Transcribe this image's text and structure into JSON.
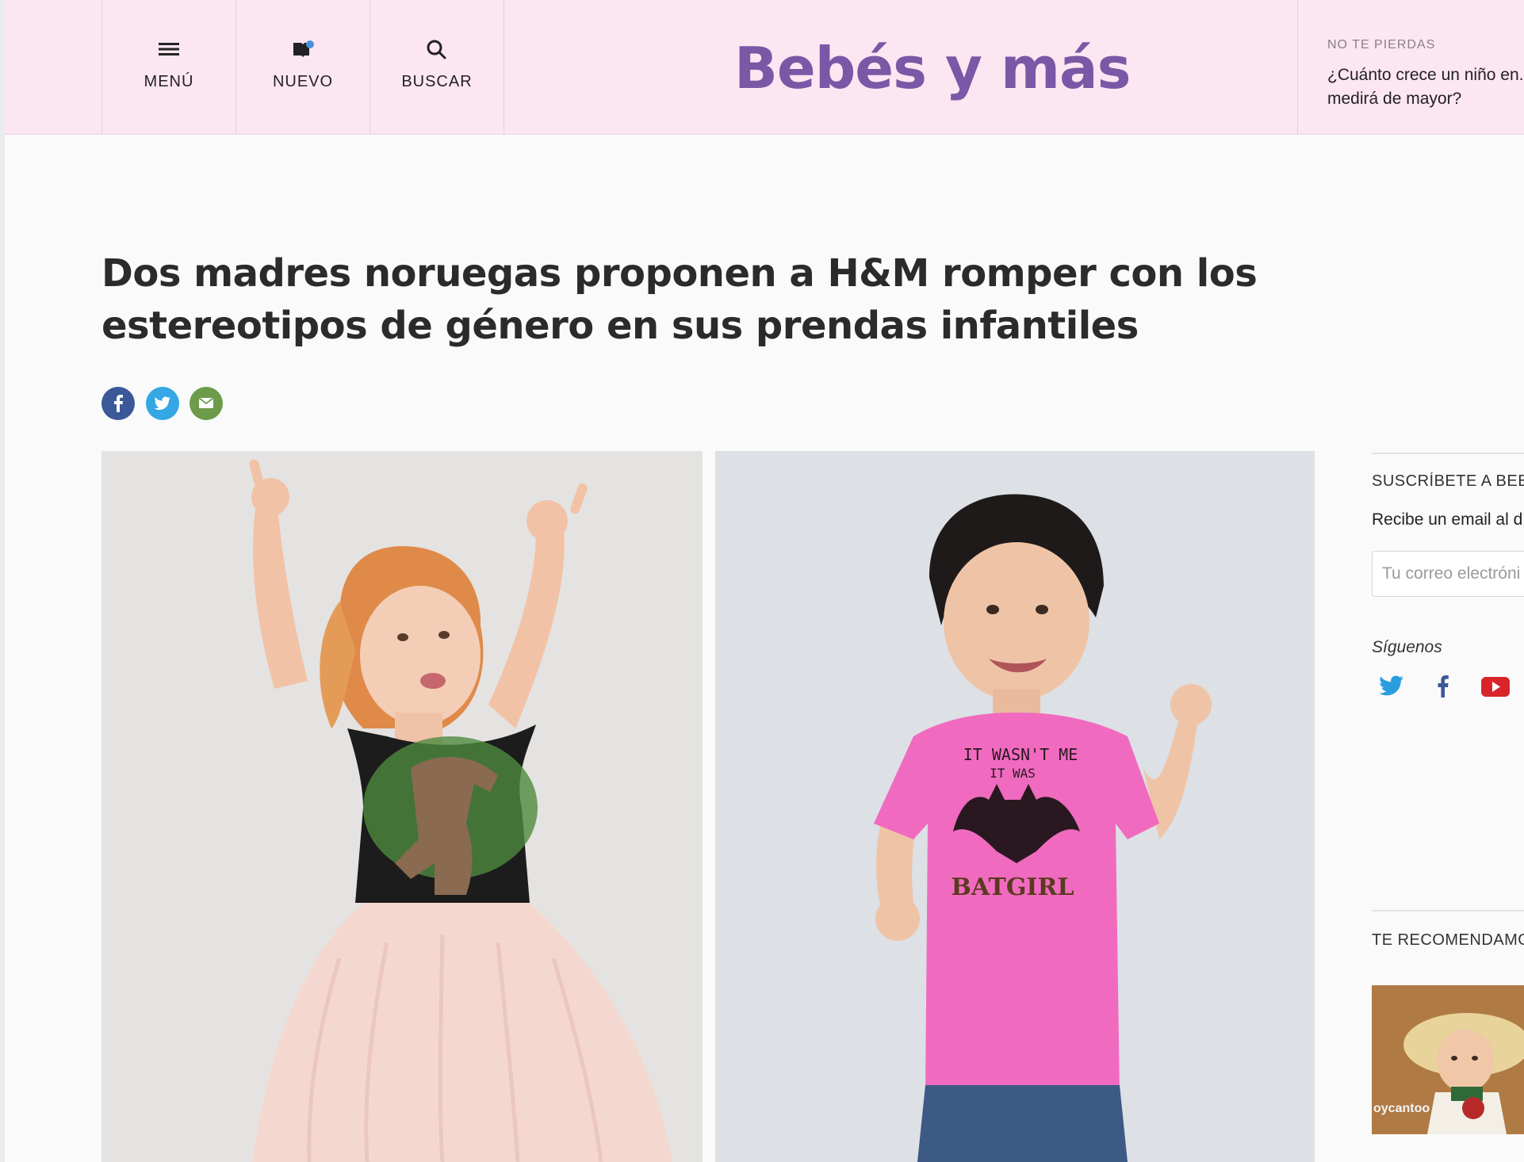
{
  "header": {
    "nav": [
      {
        "label": "MENÚ",
        "icon": "hamburger-icon"
      },
      {
        "label": "NUEVO",
        "icon": "new-book-icon"
      },
      {
        "label": "BUSCAR",
        "icon": "search-icon"
      }
    ],
    "logo": "Bebés y más",
    "promo": {
      "label": "NO TE PIERDAS",
      "text": "¿Cuánto crece un niño en... medirá de mayor?"
    },
    "colors": {
      "background": "#fce6f2",
      "logo": "#7b57a6"
    }
  },
  "article": {
    "title": "Dos madres noruegas proponen a H&M romper con los estereotipos de género en sus prendas infantiles",
    "share": [
      {
        "icon": "facebook-icon",
        "color": "#3b5998"
      },
      {
        "icon": "twitter-icon",
        "color": "#34a7e4"
      },
      {
        "icon": "email-icon",
        "color": "#6c9c4a"
      }
    ],
    "photos": {
      "left": {
        "shirt_text": ""
      },
      "right": {
        "shirt_text_line1": "IT WASN'T ME",
        "shirt_text_line2": "IT WAS",
        "shirt_text_line3": "BATGIRL"
      }
    }
  },
  "sidebar": {
    "subscribe_heading": "SUSCRÍBETE A BEBÉS Y MÁS",
    "subscribe_text": "Recibe un email al día con nuestros artículos:",
    "email_placeholder": "Tu correo electrónico",
    "follow_label": "Síguenos",
    "social": [
      "twitter-icon",
      "facebook-icon",
      "youtube-icon"
    ],
    "recommend_heading": "TE RECOMENDAMOS",
    "recommend_caption": "oycantoo"
  }
}
